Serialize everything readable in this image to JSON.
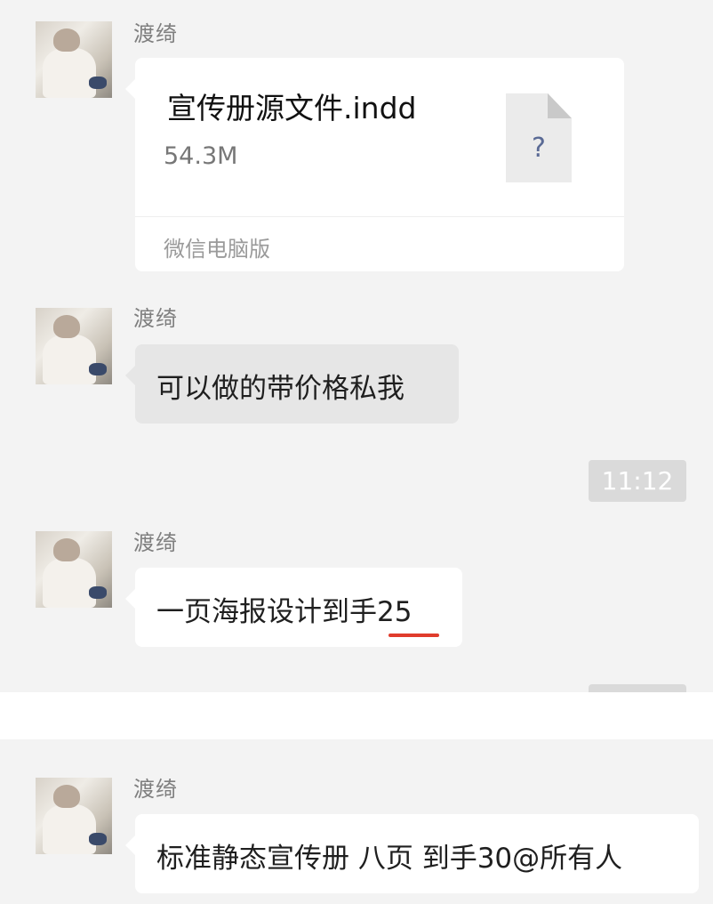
{
  "messages": [
    {
      "sender": "渡绮",
      "file": {
        "name": "宣传册源文件.indd",
        "size": "54.3M",
        "icon_glyph": "?",
        "source": "微信电脑版",
        "icon": "unknown-file-icon"
      }
    },
    {
      "sender": "渡绮",
      "text": "可以做的带价格私我"
    },
    {
      "sender": "渡绮",
      "text": "一页海报设计到手25"
    },
    {
      "sender": "渡绮",
      "text": "标准静态宣传册 八页 到手30@所有人"
    }
  ],
  "timestamp": "11:12",
  "colors": {
    "background": "#f3f3f3",
    "bubble_white": "#ffffff",
    "bubble_grey": "#e6e6e6",
    "underline_red": "#e03c2c",
    "time_badge": "#dadada"
  }
}
